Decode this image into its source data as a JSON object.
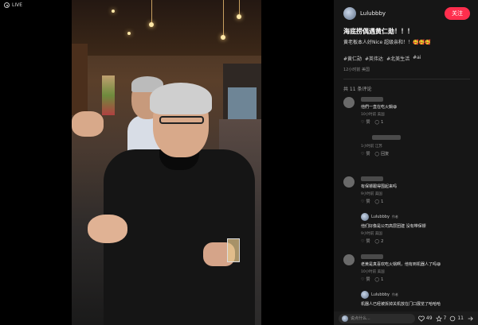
{
  "stage": {
    "live_label": "LIVE"
  },
  "author": {
    "name": "Lulubbby",
    "follow_label": "关注"
  },
  "post": {
    "title": "海底捞偶遇黄仁勋！！！",
    "description": "黄老板本人好Nice 超级亲和！！🥰🥰🥰",
    "tags": [
      "#黄仁勋",
      "#英伟达",
      "#北美生活",
      "#ai"
    ],
    "meta": "12小时前 美国"
  },
  "comments_header": "共 11 条评论",
  "comments": [
    {
      "text": "他們一直在吃火鍋😆",
      "meta": "10小时前 美国",
      "likes_label": "赞",
      "reply_count": "1"
    },
    {
      "text": "",
      "meta": "1小时前 江苏",
      "likes_label": "赞",
      "reply_count": "回复"
    },
    {
      "text": "有保镖跟得围起来吗",
      "meta": "9小时前 美国",
      "likes_label": "赞",
      "reply_count": "1"
    },
    {
      "text": "老黄是真喜欢吃火锅啊，他有到机器人了吗😆",
      "meta": "10小时前 美国",
      "likes_label": "赞",
      "reply_count": "1"
    }
  ],
  "replies": [
    {
      "author": "Lulubbby",
      "author_tag": "作者",
      "text": "他们好像是公司高层团建 没有带保镖",
      "meta": "9小时前 美国",
      "likes_label": "赞",
      "reply_count": "2"
    },
    {
      "author": "Lulubbby",
      "author_tag": "作者",
      "text": "机器人已经被拆掉关机放在门口展览了哈哈哈",
      "meta": "",
      "likes_label": "",
      "reply_count": ""
    }
  ],
  "bottom_bar": {
    "input_placeholder": "说点什么...",
    "likes": "49",
    "collects": "7",
    "comments": "11"
  }
}
